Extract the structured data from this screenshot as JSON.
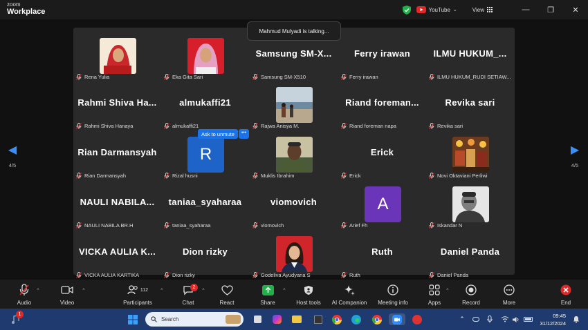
{
  "titlebar": {
    "brand_small": "zoom",
    "brand_big": "Workplace",
    "youtube_label": "YouTube",
    "view_label": "View",
    "min": "—",
    "restore": "❐",
    "close": "✕"
  },
  "toast": "Mahmud Mulyadi is talking...",
  "unmute_label": "Ask to unmute",
  "more_dots": "•••",
  "pager": {
    "left_arrow": "◀",
    "right_arrow": "▶",
    "page": "4/5"
  },
  "participants": [
    {
      "big": "",
      "label": "Rena Yulia",
      "photo": "red-hijab"
    },
    {
      "big": "",
      "label": "Eka Gita Sari",
      "photo": "pink-hijab"
    },
    {
      "big": "Samsung SM-X...",
      "label": "Samsung SM-X510"
    },
    {
      "big": "Ferry irawan",
      "label": "Ferry irawan"
    },
    {
      "big": "ILMU HUKUM_...",
      "label": "ILMU HUKUM_RUDI SETIAW..."
    },
    {
      "big": "Rahmi Shiva Ha...",
      "label": "Rahmi Shiva Hanaya"
    },
    {
      "big": "almukaffi21",
      "label": "almukaffi21"
    },
    {
      "big": "",
      "label": "Rajwa Anisya M.",
      "photo": "beach"
    },
    {
      "big": "Riand foreman...",
      "label": "Riand foreman napa"
    },
    {
      "big": "Revika sari",
      "label": "Revika sari"
    },
    {
      "big": "Rian Darmansyah",
      "label": "Rian Darmansyah"
    },
    {
      "big": "",
      "label": "Rizal husni",
      "avatar": "R",
      "avatar_color": "#1e64c8"
    },
    {
      "big": "",
      "label": "Muklis Ibrahim",
      "photo": "man-green"
    },
    {
      "big": "Erick",
      "label": "Erick"
    },
    {
      "big": "",
      "label": "Novi Oktaviani Perliwi",
      "photo": "market"
    },
    {
      "big": "NAULI NABILA...",
      "label": "NAULI NABILA BR.H"
    },
    {
      "big": "taniaa_syaharaa",
      "label": "taniaa_syaharaa"
    },
    {
      "big": "viomovich",
      "label": "viomovich"
    },
    {
      "big": "",
      "label": "Arief Fh",
      "avatar": "A",
      "avatar_color": "#6a35b8"
    },
    {
      "big": "",
      "label": "Iskandar N",
      "photo": "man-bw"
    },
    {
      "big": "VICKA AULIA K...",
      "label": "VICKA AULIA KARTIKA"
    },
    {
      "big": "Dion rizky",
      "label": "Dion rizky"
    },
    {
      "big": "",
      "label": "Godeliva Ayudyana S",
      "photo": "woman-red"
    },
    {
      "big": "Ruth",
      "label": "Ruth"
    },
    {
      "big": "Daniel Panda",
      "label": "Daniel Panda"
    }
  ],
  "toolbar": {
    "audio": "Audio",
    "video": "Video",
    "participants": "Participants",
    "participants_count": "112",
    "chat": "Chat",
    "chat_badge": "2",
    "react": "React",
    "share": "Share",
    "host_tools": "Host tools",
    "ai_companion": "AI Companion",
    "meeting_info": "Meeting info",
    "apps": "Apps",
    "record": "Record",
    "more": "More",
    "end": "End"
  },
  "taskbar": {
    "search_placeholder": "Search",
    "notif_badge": "1",
    "time": "09:45",
    "date": "31/12/2024"
  },
  "colors": {
    "accent": "#3b8ef5",
    "end_red": "#e02828",
    "share_green": "#22b04b"
  }
}
